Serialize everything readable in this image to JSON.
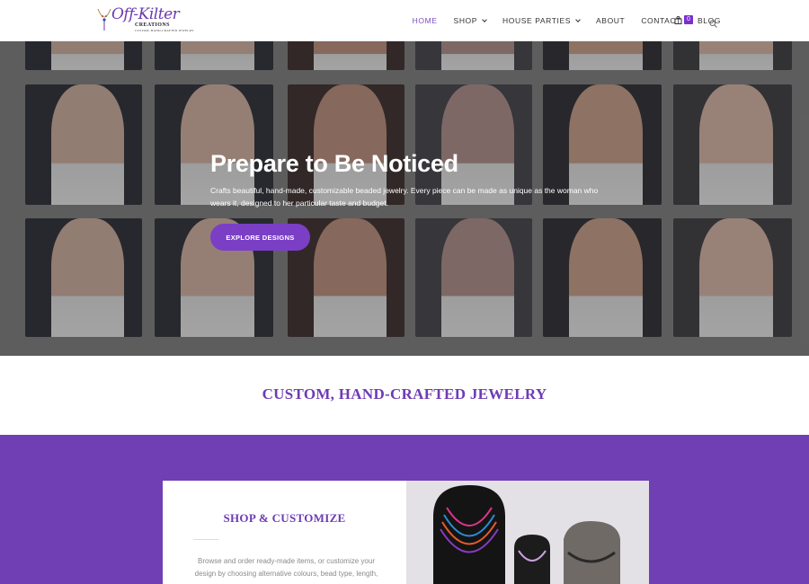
{
  "header": {
    "logo_script": "Off-Kilter",
    "logo_line1": "CREATIONS",
    "logo_line2": "CUSTOM, HAND-CRAFTED JEWELRY",
    "nav": {
      "home": "HOME",
      "shop": "SHOP",
      "house_parties": "HOUSE PARTIES",
      "about": "ABOUT",
      "contact": "CONTACT",
      "blog": "BLOG"
    },
    "cart_count": "0"
  },
  "hero": {
    "title": "Prepare to Be Noticed",
    "text": "Crafts beautiful, hand-made, customizable beaded jewelry. Every piece can be made as unique as the woman who wears it, designed to her particular taste and budget.",
    "button": "EXPLORE DESIGNS"
  },
  "section": {
    "title": "CUSTOM, HAND-CRAFTED JEWELRY"
  },
  "card": {
    "title": "SHOP & CUSTOMIZE",
    "text": "Browse and order ready-made items, or customize your design by choosing alternative colours, bead type, length,"
  },
  "colors": {
    "accent": "#7b3fc6",
    "band": "#6f3fb3",
    "heading": "#6e3bb4"
  }
}
